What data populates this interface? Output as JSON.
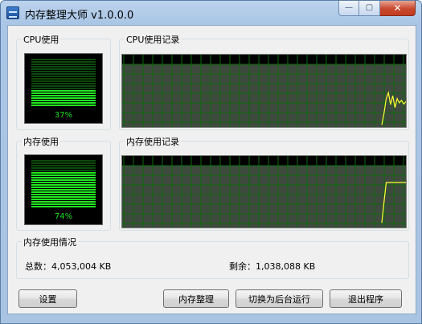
{
  "window": {
    "title": "内存整理大师 v1.0.0.0",
    "controls": {
      "minimize": "—",
      "maximize": "▢",
      "close": "✕"
    }
  },
  "cpu": {
    "group_label": "CPU使用",
    "percent_text": "37%",
    "level": 0.37,
    "history_label": "CPU使用记录"
  },
  "memory": {
    "group_label": "内存使用",
    "percent_text": "74%",
    "level": 0.74,
    "history_label": "内存使用记录"
  },
  "usage": {
    "group_label": "内存使用情况",
    "total_text": "总数：4,053,004 KB",
    "free_text": "剩余：1,038,088 KB"
  },
  "buttons": {
    "settings": "设置",
    "optimize": "内存整理",
    "background": "切换为后台运行",
    "exit": "退出程序"
  },
  "colors": {
    "meter_lit": "#22e622",
    "meter_dim": "#0c4a0c",
    "grid_fill": "#3f4a3f",
    "grid_line": "#0b6a0b",
    "trace": "#ffff33"
  },
  "chart_data": [
    {
      "type": "line",
      "name": "cpu-history",
      "ylim": [
        0,
        100
      ],
      "recent_values": [
        1,
        20,
        45,
        55,
        35,
        50,
        30,
        45,
        38,
        42,
        36,
        40
      ]
    },
    {
      "type": "line",
      "name": "memory-history",
      "ylim": [
        0,
        100
      ],
      "recent_values": [
        5,
        40,
        74,
        74,
        74,
        74,
        74,
        74,
        74,
        74,
        74,
        74
      ]
    }
  ]
}
